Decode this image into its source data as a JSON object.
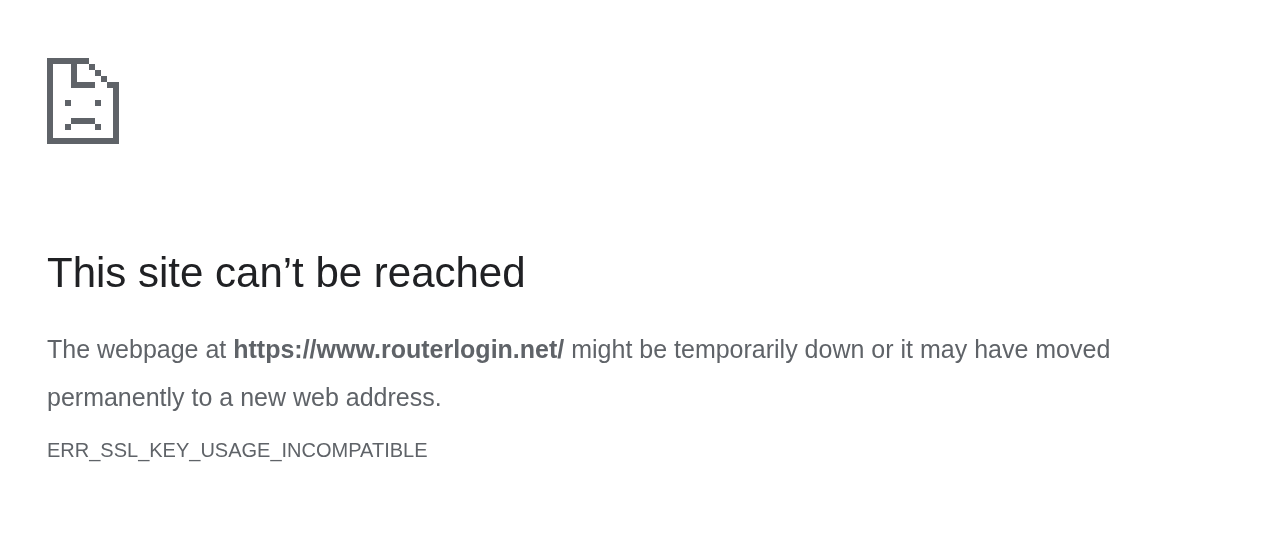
{
  "heading": "This site can’t be reached",
  "message": "The webpage at **https://www.routerlogin.net/** might be temporarily down or it may have moved permanently to a new web address.",
  "error_code": "ERR_SSL_KEY_USAGE_INCOMPATIBLE"
}
